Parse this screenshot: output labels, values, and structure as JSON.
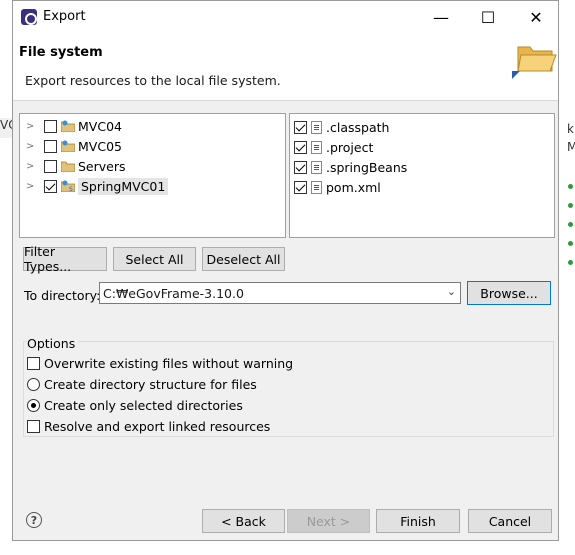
{
  "window": {
    "title": "Export"
  },
  "banner": {
    "title": "File system",
    "description": "Export resources to the local file system."
  },
  "projects": [
    {
      "label": "MVC04",
      "checked": false,
      "selected": false
    },
    {
      "label": "MVC05",
      "checked": false,
      "selected": false
    },
    {
      "label": "Servers",
      "checked": false,
      "selected": false
    },
    {
      "label": "SpringMVC01",
      "checked": true,
      "selected": true
    }
  ],
  "files": [
    {
      "label": ".classpath",
      "checked": true
    },
    {
      "label": ".project",
      "checked": true
    },
    {
      "label": ".springBeans",
      "checked": true
    },
    {
      "label": "pom.xml",
      "checked": true
    }
  ],
  "selection_buttons": {
    "filter_types": "Filter Types...",
    "select_all": "Select All",
    "deselect_all": "Deselect All"
  },
  "directory": {
    "label": "To directory:",
    "value": "C:₩eGovFrame-3.10.0",
    "browse": "Browse..."
  },
  "options": {
    "title": "Options",
    "overwrite": "Overwrite existing files without warning",
    "create_structure": "Create directory structure for files",
    "create_selected": "Create only selected directories",
    "resolve_linked": "Resolve and export linked resources",
    "selected_mode": "create_selected"
  },
  "nav": {
    "back": "< Back",
    "next": "Next >",
    "finish": "Finish",
    "cancel": "Cancel"
  },
  "icons": {
    "help": "?",
    "minimize": "—",
    "maximize": "☐",
    "close": "✕"
  },
  "background_ide": {
    "left_text": "VC",
    "right_letters": [
      "k",
      "M"
    ]
  },
  "colors": {
    "focus_border": "#0078d7",
    "selection_bg": "#e5e5e5",
    "dialog_bg": "#f0f0f0"
  }
}
